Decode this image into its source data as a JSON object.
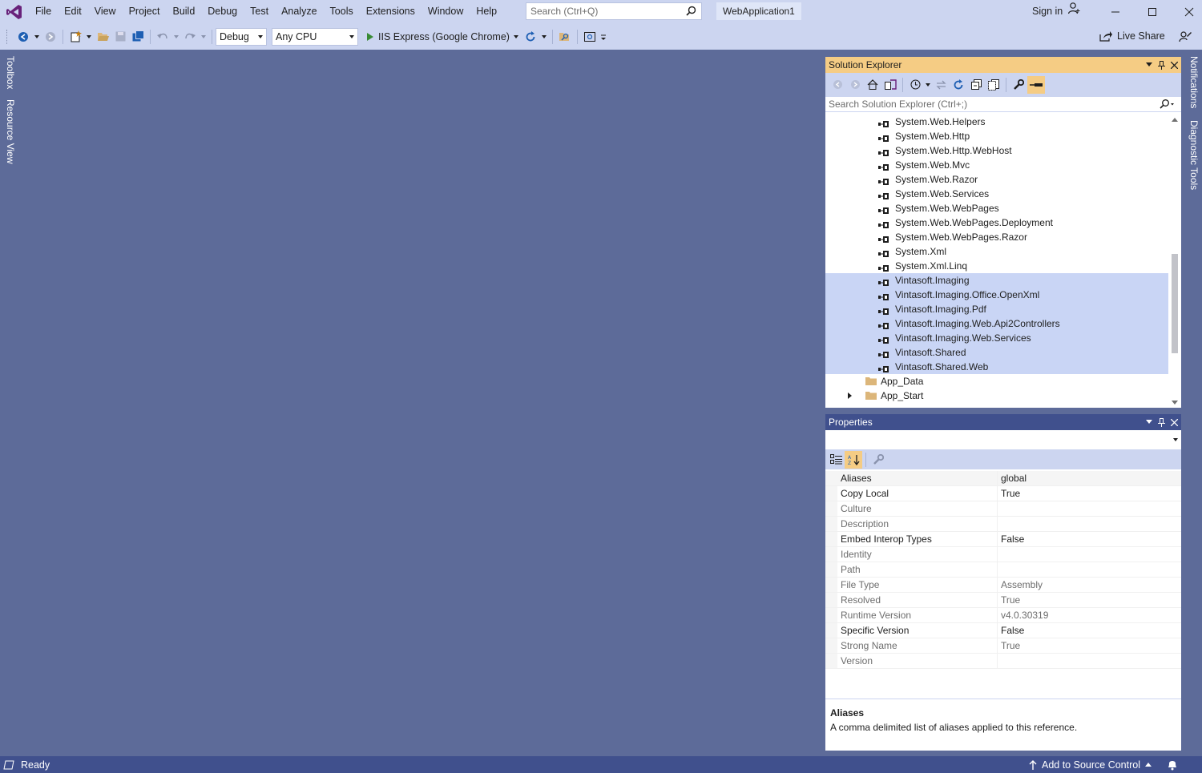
{
  "menu": [
    "File",
    "Edit",
    "View",
    "Project",
    "Build",
    "Debug",
    "Test",
    "Analyze",
    "Tools",
    "Extensions",
    "Window",
    "Help"
  ],
  "search": {
    "placeholder": "Search (Ctrl+Q)"
  },
  "solution_name": "WebApplication1",
  "signin": "Sign in",
  "toolbar": {
    "config": "Debug",
    "platform": "Any CPU",
    "run_target": "IIS Express (Google Chrome)",
    "live_share": "Live Share"
  },
  "left_tabs": [
    "Toolbox",
    "Resource View"
  ],
  "right_tabs": [
    "Notifications",
    "Diagnostic Tools"
  ],
  "solution_explorer": {
    "title": "Solution Explorer",
    "search_placeholder": "Search Solution Explorer (Ctrl+;)",
    "references": [
      {
        "label": "System.Web.Helpers",
        "selected": false
      },
      {
        "label": "System.Web.Http",
        "selected": false
      },
      {
        "label": "System.Web.Http.WebHost",
        "selected": false
      },
      {
        "label": "System.Web.Mvc",
        "selected": false
      },
      {
        "label": "System.Web.Razor",
        "selected": false
      },
      {
        "label": "System.Web.Services",
        "selected": false
      },
      {
        "label": "System.Web.WebPages",
        "selected": false
      },
      {
        "label": "System.Web.WebPages.Deployment",
        "selected": false
      },
      {
        "label": "System.Web.WebPages.Razor",
        "selected": false
      },
      {
        "label": "System.Xml",
        "selected": false
      },
      {
        "label": "System.Xml.Linq",
        "selected": false
      },
      {
        "label": "Vintasoft.Imaging",
        "selected": true
      },
      {
        "label": "Vintasoft.Imaging.Office.OpenXml",
        "selected": true
      },
      {
        "label": "Vintasoft.Imaging.Pdf",
        "selected": true
      },
      {
        "label": "Vintasoft.Imaging.Web.Api2Controllers",
        "selected": true
      },
      {
        "label": "Vintasoft.Imaging.Web.Services",
        "selected": true
      },
      {
        "label": "Vintasoft.Shared",
        "selected": true
      },
      {
        "label": "Vintasoft.Shared.Web",
        "selected": true
      }
    ],
    "folders": [
      {
        "label": "App_Data",
        "expandable": false
      },
      {
        "label": "App_Start",
        "expandable": true
      }
    ]
  },
  "properties": {
    "title": "Properties",
    "rows": [
      {
        "name": "Aliases",
        "value": "global",
        "dim": false
      },
      {
        "name": "Copy Local",
        "value": "True",
        "dim": false
      },
      {
        "name": "Culture",
        "value": "",
        "dim": true
      },
      {
        "name": "Description",
        "value": "",
        "dim": true
      },
      {
        "name": "Embed Interop Types",
        "value": "False",
        "dim": false
      },
      {
        "name": "Identity",
        "value": "",
        "dim": true
      },
      {
        "name": "Path",
        "value": "",
        "dim": true
      },
      {
        "name": "File Type",
        "value": "Assembly",
        "dim": true
      },
      {
        "name": "Resolved",
        "value": "True",
        "dim": true
      },
      {
        "name": "Runtime Version",
        "value": "v4.0.30319",
        "dim": true
      },
      {
        "name": "Specific Version",
        "value": "False",
        "dim": false
      },
      {
        "name": "Strong Name",
        "value": "True",
        "dim": true
      },
      {
        "name": "Version",
        "value": "",
        "dim": true
      }
    ],
    "description_title": "Aliases",
    "description_text": "A comma delimited list of aliases applied to this reference."
  },
  "status": {
    "text": "Ready",
    "source_control": "Add to Source Control"
  },
  "colors": {
    "background": "#5d6b99",
    "chrome": "#ccd5f0",
    "accent_tab": "#f5cc84",
    "status_bar": "#40508d",
    "selection": "#c9d5f5"
  }
}
